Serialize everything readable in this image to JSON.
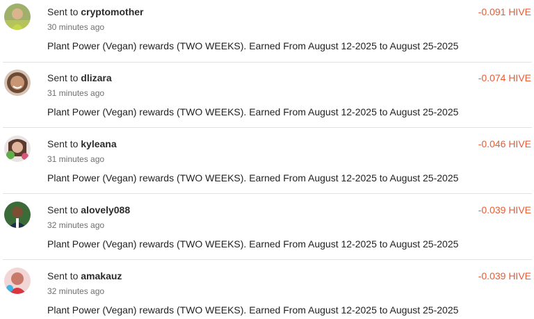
{
  "theme": {
    "amount_color": "#ee5a2f"
  },
  "transfers": [
    {
      "prefix": "Sent to",
      "user": "cryptomother",
      "time": "30 minutes ago",
      "memo": "Plant Power (Vegan) rewards (TWO WEEKS). Earned From August 12-2025 to August 25-2025",
      "amount": "-0.091 HIVE"
    },
    {
      "prefix": "Sent to",
      "user": "dlizara",
      "time": "31 minutes ago",
      "memo": "Plant Power (Vegan) rewards (TWO WEEKS). Earned From August 12-2025 to August 25-2025",
      "amount": "-0.074 HIVE"
    },
    {
      "prefix": "Sent to",
      "user": "kyleana",
      "time": "31 minutes ago",
      "memo": "Plant Power (Vegan) rewards (TWO WEEKS). Earned From August 12-2025 to August 25-2025",
      "amount": "-0.046 HIVE"
    },
    {
      "prefix": "Sent to",
      "user": "alovely088",
      "time": "32 minutes ago",
      "memo": "Plant Power (Vegan) rewards (TWO WEEKS). Earned From August 12-2025 to August 25-2025",
      "amount": "-0.039 HIVE"
    },
    {
      "prefix": "Sent to",
      "user": "amakauz",
      "time": "32 minutes ago",
      "memo": "Plant Power (Vegan) rewards (TWO WEEKS). Earned From August 12-2025 to August 25-2025",
      "amount": "-0.039 HIVE"
    }
  ]
}
